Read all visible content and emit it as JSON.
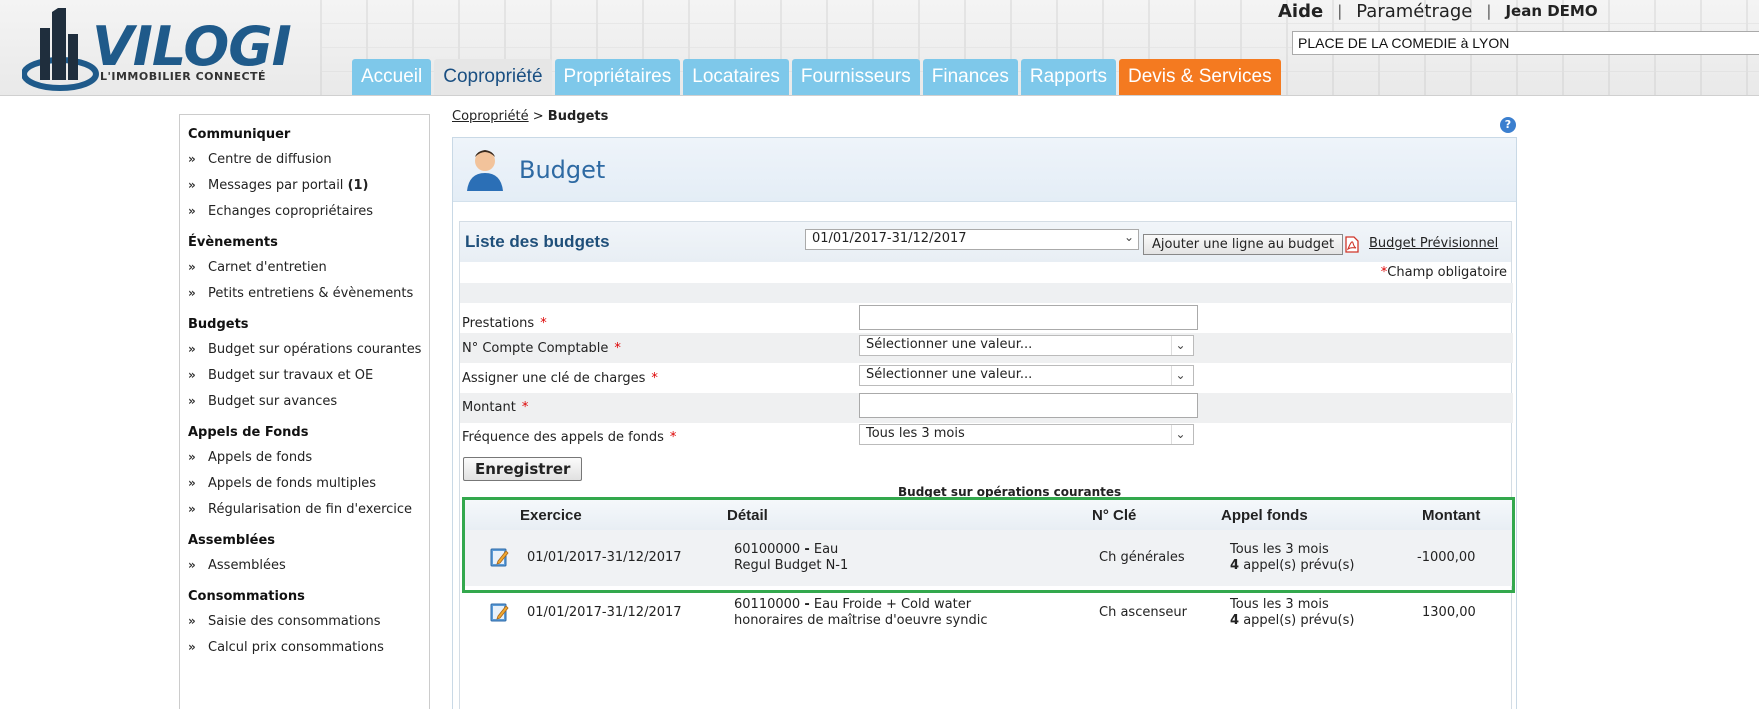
{
  "header": {
    "logo_name": "VILOGI",
    "logo_tagline": "L'IMMOBILIER CONNECTÉ",
    "links": {
      "help": "Aide",
      "settings": "Paramétrage",
      "user": "Jean DEMO"
    },
    "building": "PLACE DE LA COMEDIE à LYON",
    "tabs": [
      {
        "label": "Accueil"
      },
      {
        "label": "Copropriété"
      },
      {
        "label": "Propriétaires"
      },
      {
        "label": "Locataires"
      },
      {
        "label": "Fournisseurs"
      },
      {
        "label": "Finances"
      },
      {
        "label": "Rapports"
      },
      {
        "label": "Devis & Services"
      }
    ],
    "colors": {
      "tab": "#7ec8ea",
      "active_tab_text": "#1a4f82",
      "services_tab": "#f47a20"
    }
  },
  "sidebar": {
    "sections": [
      {
        "title": "Communiquer",
        "items": [
          "Centre de diffusion",
          "Messages par portail",
          "Echanges copropriétaires"
        ],
        "badge": "(1)"
      },
      {
        "title": "Évènements",
        "items": [
          "Carnet d'entretien",
          "Petits entretiens & évènements"
        ]
      },
      {
        "title": "Budgets",
        "items": [
          "Budget sur opérations courantes",
          "Budget sur travaux et OE",
          "Budget sur avances"
        ]
      },
      {
        "title": "Appels de Fonds",
        "items": [
          "Appels de fonds",
          "Appels de fonds multiples",
          "Régularisation de fin d'exercice"
        ]
      },
      {
        "title": "Assemblées",
        "items": [
          "Assemblées"
        ]
      },
      {
        "title": "Consommations",
        "items": [
          "Saisie des consommations",
          "Calcul prix consommations"
        ]
      }
    ]
  },
  "breadcrumb": {
    "parent": "Copropriété",
    "separator": ">",
    "current": "Budgets"
  },
  "help_icon": "?",
  "panel": {
    "title": "Budget",
    "list_title": "Liste des budgets",
    "period": "01/01/2017-31/12/2017",
    "add_button": "Ajouter une ligne au budget",
    "forecast_link": "Budget Prévisionnel",
    "mandatory_note": "Champ obligatoire",
    "mandatory_star": "*"
  },
  "form": {
    "prestations_label": "Prestations",
    "account_label": "N° Compte Comptable",
    "account_value": "Sélectionner une valeur...",
    "key_label": "Assigner une clé de charges",
    "key_value": "Sélectionner une valeur...",
    "amount_label": "Montant",
    "frequency_label": "Fréquence des appels de fonds",
    "frequency_value": "Tous les 3 mois",
    "save_button": "Enregistrer",
    "star": "*"
  },
  "table": {
    "caption": "Budget sur opérations courantes",
    "headers": {
      "exercice": "Exercice",
      "detail": "Détail",
      "cle": "N° Clé",
      "appel": "Appel fonds",
      "montant": "Montant"
    },
    "rows": [
      {
        "exercice": "01/01/2017-31/12/2017",
        "account": "60100000",
        "account_name": "Eau",
        "detail_sub": "Regul Budget N-1",
        "cle": "Ch générales",
        "frequency": "Tous les 3 mois",
        "calls_count": "4",
        "calls_text": "appel(s) prévu(s)",
        "montant": "-1000,00"
      },
      {
        "exercice": "01/01/2017-31/12/2017",
        "account": "60110000",
        "account_name": "Eau Froide + Cold water",
        "detail_sub": "honoraires de maîtrise d'oeuvre syndic",
        "cle": "Ch ascenseur",
        "frequency": "Tous les 3 mois",
        "calls_count": "4",
        "calls_text": "appel(s) prévu(s)",
        "montant": "1300,00"
      }
    ]
  },
  "highlight_color": "#33a84d"
}
